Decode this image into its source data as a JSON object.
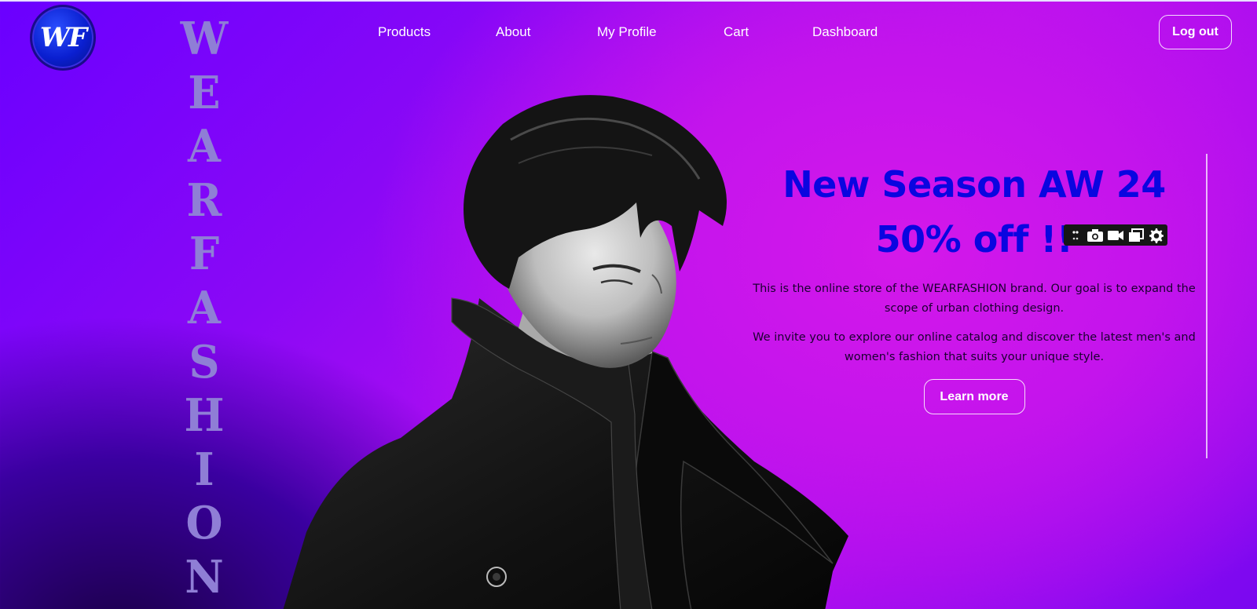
{
  "brand": {
    "logo_text": "WF",
    "vertical_letters": [
      "W",
      "E",
      "A",
      "R",
      "F",
      "A",
      "S",
      "H",
      "I",
      "O",
      "N"
    ]
  },
  "nav": {
    "items": [
      "Products",
      "About",
      "My Profile",
      "Cart",
      "Dashboard"
    ],
    "logout_label": "Log out"
  },
  "hero": {
    "headline_1": "New Season AW 24",
    "headline_2": "50% off !!",
    "paragraph_1": "This is the online store of the WEARFASHION brand. Our goal is to expand the scope of urban clothing design.",
    "paragraph_2": "We invite you to explore our online catalog and discover the latest men's and women's fashion that suits your unique style.",
    "cta_label": "Learn more"
  },
  "capture_toolbar": {
    "icons": [
      "grip-icon",
      "camera-icon",
      "video-camera-icon",
      "window-icon",
      "gear-icon"
    ]
  },
  "colors": {
    "headline": "#0a05e0",
    "vertical_brand": "#8f7ed6",
    "body_text": "#1a0030",
    "gradient_magenta": "#d418ea",
    "gradient_violet": "#6a00ff"
  }
}
